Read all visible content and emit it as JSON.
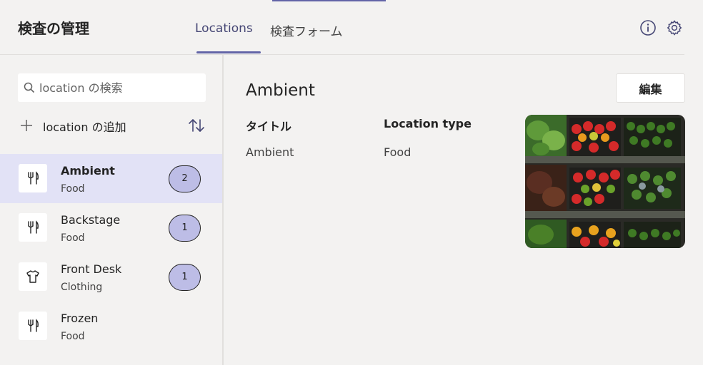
{
  "header": {
    "app_title": "検査の管理",
    "tabs": [
      {
        "label": "Locations",
        "selected": true
      },
      {
        "label": "検査フォーム",
        "selected": false
      }
    ],
    "info_icon": "info-icon",
    "settings_icon": "gear-icon"
  },
  "sidebar": {
    "search": {
      "placeholder": "location の検索",
      "value": ""
    },
    "add_label": "location の追加",
    "sort_icon": "sort-icon",
    "items": [
      {
        "name": "Ambient",
        "type": "Food",
        "icon": "fork-knife-icon",
        "badge": "2",
        "selected": true
      },
      {
        "name": "Backstage",
        "type": "Food",
        "icon": "fork-knife-icon",
        "badge": "1",
        "selected": false
      },
      {
        "name": "Front Desk",
        "type": "Clothing",
        "icon": "shirt-icon",
        "badge": "1",
        "selected": false
      },
      {
        "name": "Frozen",
        "type": "Food",
        "icon": "fork-knife-icon",
        "badge": "",
        "selected": false
      }
    ]
  },
  "detail": {
    "title": "Ambient",
    "edit_label": "編集",
    "fields": [
      {
        "label": "タイトル",
        "value": "Ambient"
      },
      {
        "label": "Location type",
        "value": "Food"
      }
    ],
    "image": "produce-shelves-photo"
  },
  "colors": {
    "accent": "#6264a7",
    "selected_bg": "#e2e2f6",
    "badge_bg": "#bdbde6",
    "page_bg": "#f3f2f1"
  }
}
